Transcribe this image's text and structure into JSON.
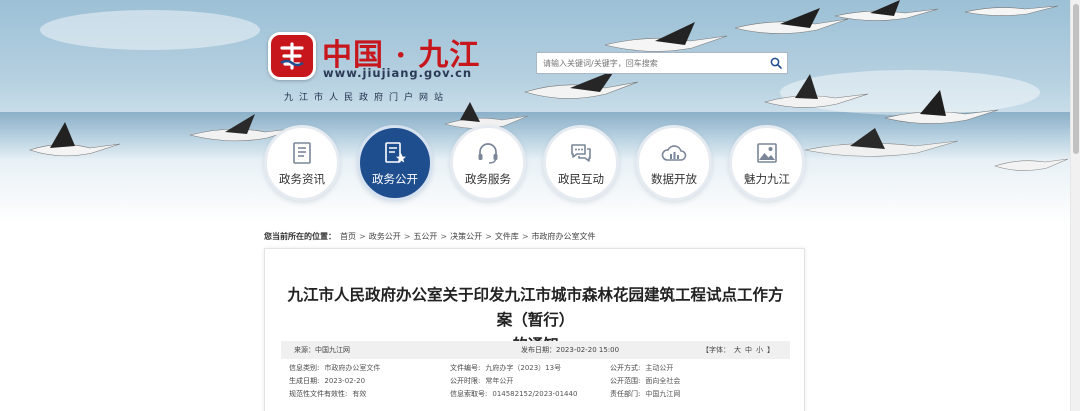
{
  "header": {
    "site_title": "中国 · 九江",
    "site_url": "www.jiujiang.gov.cn",
    "site_subtitle": "九江市人民政府门户网站",
    "logo_icon": "jiujiang-logo-icon"
  },
  "search": {
    "placeholder": "请输入关键词/关键字，回车搜索",
    "button_icon": "search-icon"
  },
  "nav": {
    "items": [
      {
        "label": "政务资讯",
        "icon": "newspaper-icon"
      },
      {
        "label": "政务公开",
        "icon": "document-star-icon",
        "active": true
      },
      {
        "label": "政务服务",
        "icon": "headset-icon"
      },
      {
        "label": "政民互动",
        "icon": "chat-bubbles-icon"
      },
      {
        "label": "数据开放",
        "icon": "cloud-chart-icon"
      },
      {
        "label": "魅力九江",
        "icon": "picture-icon"
      }
    ]
  },
  "breadcrumb": {
    "label": "您当前所在的位置：",
    "items": [
      "首页",
      "政务公开",
      "五公开",
      "决策公开",
      "文件库",
      "市政府办公室文件"
    ],
    "separator": ">"
  },
  "article": {
    "title_line1": "九江市人民政府办公室关于印发九江市城市森林花园建筑工程试点工作方案（暂行）",
    "title_line2": "的通知",
    "source": "来源：中国九江网",
    "publish_date": "发布日期：2023-02-20 15:00",
    "font_size_label": "【字体：",
    "font_large": "大",
    "font_medium": "中",
    "font_small": "小",
    "font_close": "】",
    "info": [
      [
        {
          "key": "信息类别:",
          "value": "市政府办公室文件"
        },
        {
          "key": "文件编号:",
          "value": "九府办字（2023）13号"
        },
        {
          "key": "公开方式:",
          "value": "主动公开"
        }
      ],
      [
        {
          "key": "生成日期:",
          "value": "2023-02-20"
        },
        {
          "key": "公开时限:",
          "value": "常年公开"
        },
        {
          "key": "公开范围:",
          "value": "面向全社会"
        }
      ],
      [
        {
          "key": "规范性文件有效性:",
          "value": "有效"
        },
        {
          "key": "信息索取号:",
          "value": "014582152/2023-01440"
        },
        {
          "key": "责任部门:",
          "value": "中国九江网"
        }
      ]
    ]
  },
  "colors": {
    "brand_red": "#c8161d",
    "nav_active": "#1f4e8f"
  }
}
